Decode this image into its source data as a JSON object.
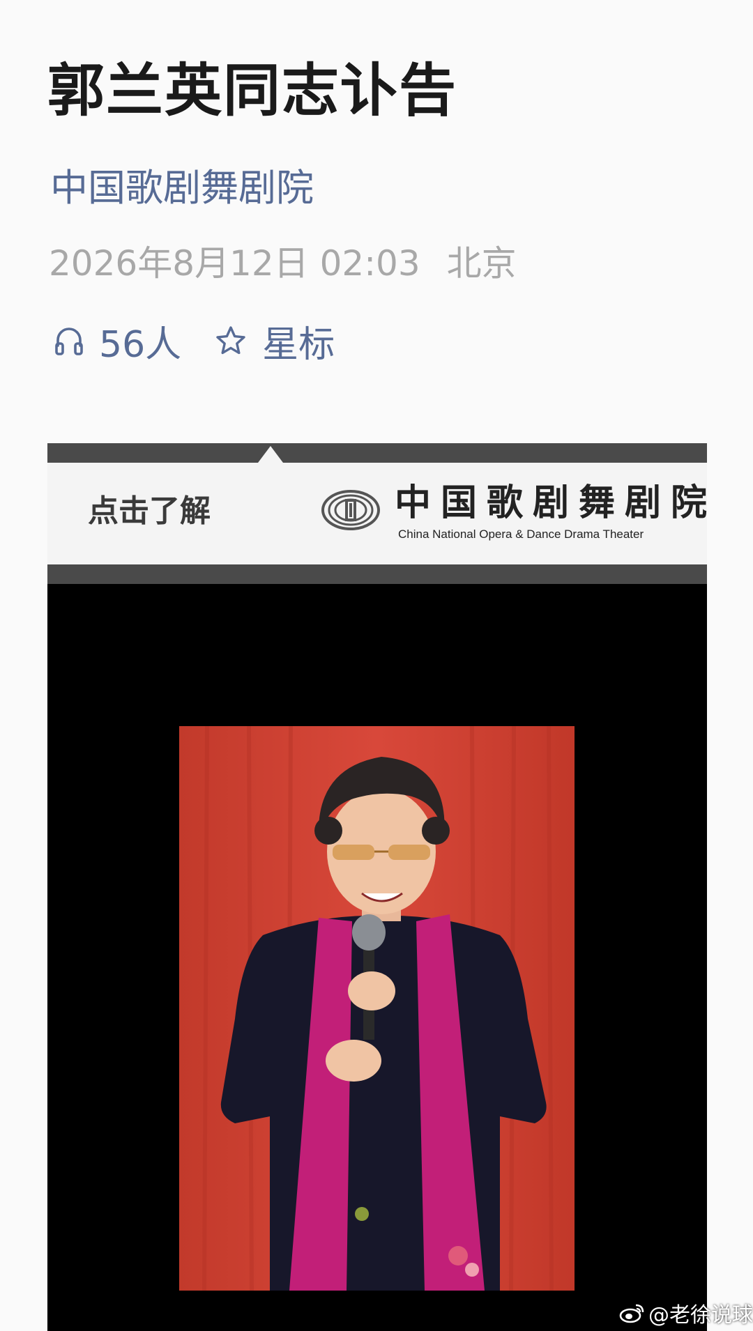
{
  "article": {
    "title": "郭兰英同志讣告",
    "account_name": "中国歌剧舞剧院",
    "date": "2026年8月12日 02:03",
    "location": "北京"
  },
  "actions": {
    "listen_icon": "headphones-icon",
    "listen_count": "56人",
    "star_icon": "star-outline-icon",
    "star_label": "星标"
  },
  "cover": {
    "banner_cta": "点击了解",
    "org_name_cn": "中国歌剧舞剧院",
    "org_name_en": "China National Opera & Dance Drama Theater",
    "logo_icon": "theater-logo-icon",
    "background_color": "#000000",
    "portrait_background": "#d2402f"
  },
  "watermark": {
    "icon": "weibo-icon",
    "text": "@老徐说球"
  },
  "colors": {
    "title": "#1a1a1a",
    "link": "#576b95",
    "meta": "#a8a8a8"
  }
}
